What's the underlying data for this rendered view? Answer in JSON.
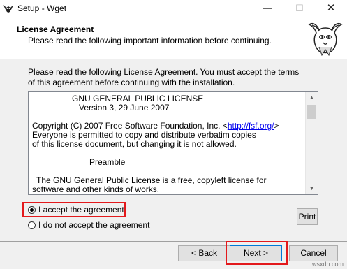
{
  "window": {
    "title": "Setup - Wget"
  },
  "header": {
    "title": "License Agreement",
    "subtitle": "Please read the following important information before continuing."
  },
  "intro_text": "Please read the following License Agreement. You must accept the terms of this agreement before continuing with the installation.",
  "license": {
    "heading_line1": "GNU GENERAL PUBLIC LICENSE",
    "heading_line2": "Version 3, 29 June 2007",
    "copyright_prefix": "Copyright (C) 2007 Free Software Foundation, Inc. <",
    "copyright_link": "http://fsf.org/",
    "copyright_suffix": ">",
    "copy_line2": "Everyone is permitted to copy and distribute verbatim copies",
    "copy_line3": "of this license document, but changing it is not allowed.",
    "preamble": "Preamble",
    "para1_line1": "The GNU General Public License is a free, copyleft license for",
    "para1_line2": "software and other kinds of works."
  },
  "options": {
    "accept_label": "I accept the agreement",
    "decline_label": "I do not accept the agreement",
    "selected": "accept"
  },
  "buttons": {
    "print": "Print",
    "back": "< Back",
    "next": "Next >",
    "cancel": "Cancel"
  },
  "watermark": "wsxdn.com",
  "colors": {
    "highlight": "#e3191c",
    "link": "#0000ee"
  }
}
